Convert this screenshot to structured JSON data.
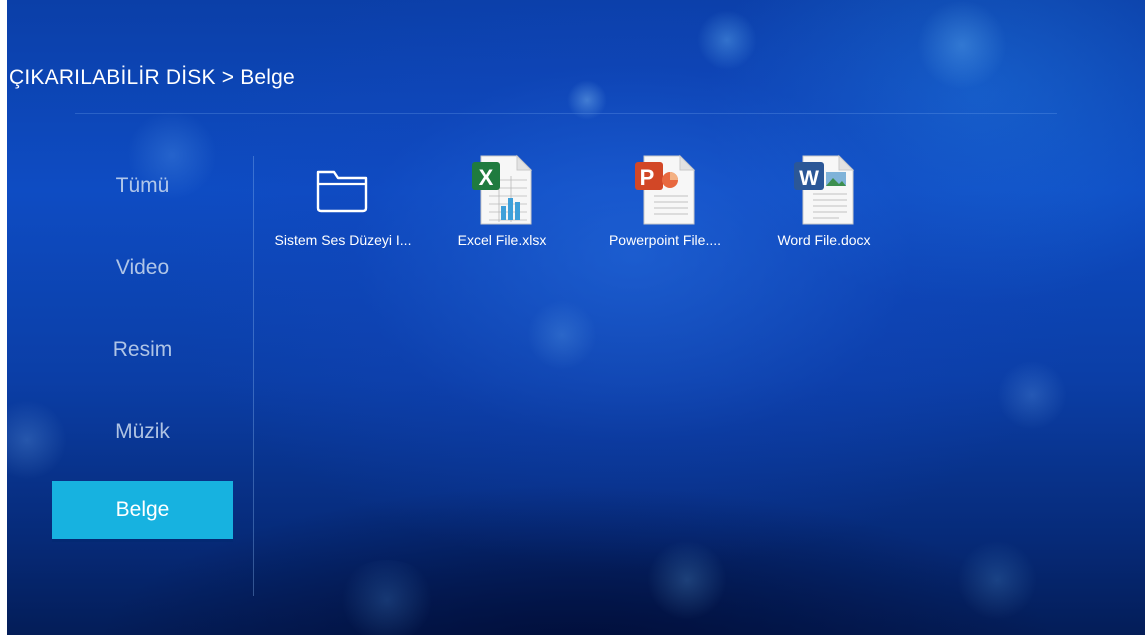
{
  "breadcrumb": {
    "text": "ÇIKARILABİLİR DİSK > Belge"
  },
  "sidebar": {
    "items": [
      {
        "label": "Tümü",
        "active": false
      },
      {
        "label": "Video",
        "active": false
      },
      {
        "label": "Resim",
        "active": false
      },
      {
        "label": "Müzik",
        "active": false
      },
      {
        "label": "Belge",
        "active": true
      }
    ]
  },
  "files": [
    {
      "name": "Sistem Ses Düzeyi I...",
      "type": "folder",
      "icon": "folder-icon"
    },
    {
      "name": "Excel File.xlsx",
      "type": "xlsx",
      "icon": "excel-file-icon"
    },
    {
      "name": "Powerpoint File....",
      "type": "pptx",
      "icon": "powerpoint-file-icon"
    },
    {
      "name": "Word File.docx",
      "type": "docx",
      "icon": "word-file-icon"
    }
  ],
  "colors": {
    "active_tab": "#17b2e0",
    "background": "#0b3fa8",
    "excel": "#1f7b3f",
    "powerpoint": "#d24726",
    "word": "#2b5797"
  }
}
